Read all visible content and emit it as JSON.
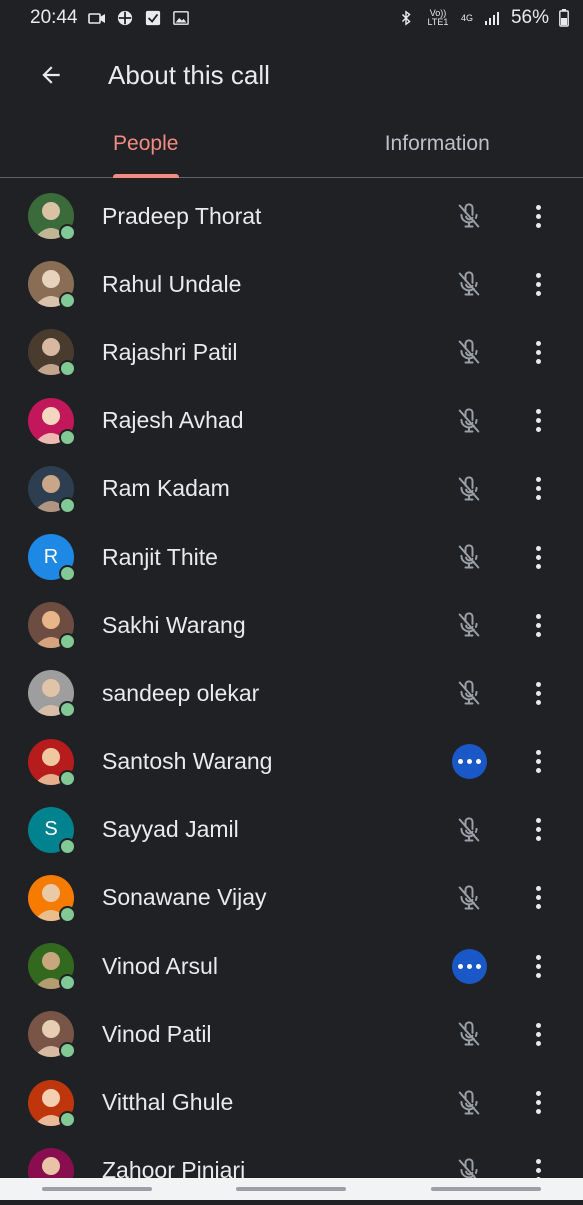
{
  "status": {
    "time": "20:44",
    "network": "4G",
    "volte": "Vo)) LTE1",
    "battery": "56%"
  },
  "header": {
    "title": "About this call"
  },
  "tabs": [
    {
      "label": "People",
      "active": true
    },
    {
      "label": "Information",
      "active": false
    }
  ],
  "participants": [
    {
      "name": "Pradeep Thorat",
      "status": "muted",
      "avatar": "photo"
    },
    {
      "name": "Rahul Undale",
      "status": "muted",
      "avatar": "photo"
    },
    {
      "name": "Rajashri Patil",
      "status": "muted",
      "avatar": "photo"
    },
    {
      "name": "Rajesh Avhad",
      "status": "muted",
      "avatar": "photo"
    },
    {
      "name": "Ram Kadam",
      "status": "muted",
      "avatar": "photo"
    },
    {
      "name": "Ranjit Thite",
      "status": "muted",
      "avatar": "initial",
      "initial": "R",
      "color": "#1e88e5"
    },
    {
      "name": "Sakhi Warang",
      "status": "muted",
      "avatar": "photo"
    },
    {
      "name": "sandeep olekar",
      "status": "muted",
      "avatar": "photo"
    },
    {
      "name": "Santosh Warang",
      "status": "speaking",
      "avatar": "photo"
    },
    {
      "name": "Sayyad Jamil",
      "status": "muted",
      "avatar": "initial",
      "initial": "S",
      "color": "#00838f"
    },
    {
      "name": "Sonawane Vijay",
      "status": "muted",
      "avatar": "photo"
    },
    {
      "name": "Vinod Arsul",
      "status": "speaking",
      "avatar": "photo"
    },
    {
      "name": "Vinod Patil",
      "status": "muted",
      "avatar": "photo"
    },
    {
      "name": "Vitthal Ghule",
      "status": "muted",
      "avatar": "photo"
    },
    {
      "name": "Zahoor Pinjari",
      "status": "muted",
      "avatar": "photo"
    }
  ],
  "colors": {
    "background": "#202124",
    "accent": "#f28b82",
    "speaking": "#1a57c7",
    "presence": "#81c995"
  },
  "icons": {
    "back": "arrow-back-icon",
    "muted": "mic-off-icon",
    "speaking": "audio-activity-icon",
    "more": "more-vert-icon"
  }
}
